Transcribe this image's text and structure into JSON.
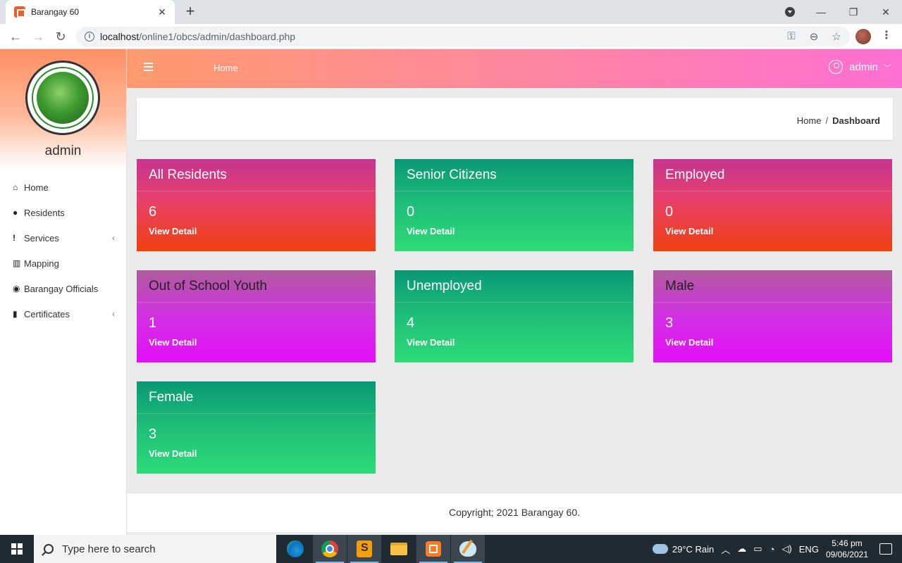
{
  "browser": {
    "tab_title": "Barangay 60",
    "url_host": "localhost",
    "url_path": "/online1/obcs/admin/dashboard.php"
  },
  "sidebar": {
    "logo_top_text": "BARANGAY 60 - LETSUGAS",
    "logo_bottom_text": "CAVITE CITY, CAVITE",
    "username": "admin",
    "items": [
      {
        "label": "Home",
        "icon": "home-icon"
      },
      {
        "label": "Residents",
        "icon": "user-icon"
      },
      {
        "label": "Services",
        "icon": "exclamation-icon",
        "has_submenu": true
      },
      {
        "label": "Mapping",
        "icon": "map-icon"
      },
      {
        "label": "Barangay Officials",
        "icon": "user-circle-icon"
      },
      {
        "label": "Certificates",
        "icon": "file-icon",
        "has_submenu": true
      }
    ]
  },
  "topbar": {
    "home_label": "Home",
    "user_label": "admin"
  },
  "breadcrumb": {
    "home": "Home",
    "separator": "/",
    "current": "Dashboard"
  },
  "cards": [
    {
      "title": "All Residents",
      "count": "6",
      "link": "View Detail"
    },
    {
      "title": "Senior Citizens",
      "count": "0",
      "link": "View Detail"
    },
    {
      "title": "Employed",
      "count": "0",
      "link": "View Detail"
    },
    {
      "title": "Out of School Youth",
      "count": "1",
      "link": "View Detail"
    },
    {
      "title": "Unemployed",
      "count": "4",
      "link": "View Detail"
    },
    {
      "title": "Male",
      "count": "3",
      "link": "View Detail"
    },
    {
      "title": "Female",
      "count": "3",
      "link": "View Detail"
    }
  ],
  "footer": {
    "text": "Copyright; 2021 Barangay 60."
  },
  "taskbar": {
    "search_placeholder": "Type here to search",
    "weather": "29°C  Rain",
    "language": "ENG",
    "time": "5:46 pm",
    "date": "09/06/2021"
  },
  "colors": {
    "topbar_start": "#ff9a6c",
    "topbar_end": "#ff6fd2",
    "card_red": "#f0400e",
    "card_green": "#2edb78",
    "card_purple": "#e40ef9"
  }
}
